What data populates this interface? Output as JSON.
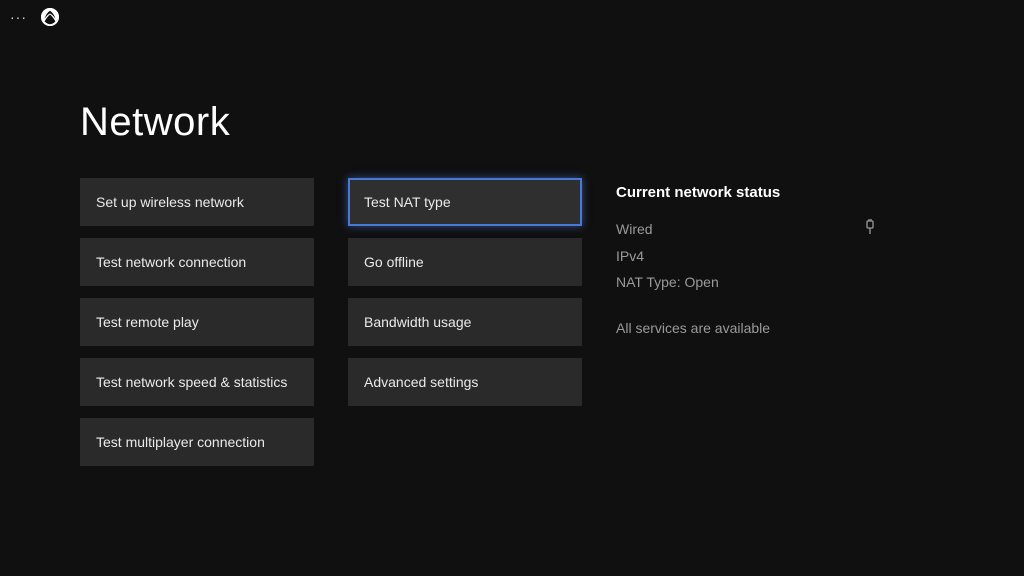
{
  "topbar": {
    "ellipsis": "···"
  },
  "page": {
    "title": "Network"
  },
  "column1": [
    {
      "label": "Set up wireless network"
    },
    {
      "label": "Test network connection"
    },
    {
      "label": "Test remote play"
    },
    {
      "label": "Test network speed & statistics"
    },
    {
      "label": "Test multiplayer connection"
    }
  ],
  "column2": [
    {
      "label": "Test NAT type",
      "selected": true
    },
    {
      "label": "Go offline"
    },
    {
      "label": "Bandwidth usage"
    },
    {
      "label": "Advanced settings"
    }
  ],
  "status": {
    "title": "Current network status",
    "line1": "Wired",
    "line2": "IPv4",
    "line3": "NAT Type: Open",
    "line4": "All services are available"
  }
}
